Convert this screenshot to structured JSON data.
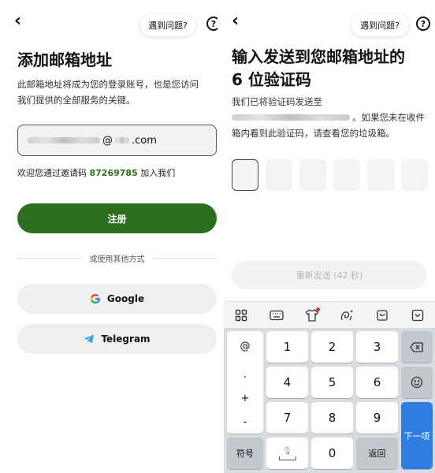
{
  "left": {
    "problem_label": "遇到问题?",
    "help_glyph": "?",
    "back_glyph": "‹",
    "title": "添加邮箱地址",
    "description_line1": "此邮箱地址将成为您的登录账号，也是您访问",
    "description_line2": "我们提供的全部服务的关键。",
    "email_visible_suffix": ".com",
    "email_visible_at": "@",
    "invite_prefix": "欢迎您通过邀请码",
    "invite_code": "87269785",
    "invite_suffix": "加入我们",
    "register_label": "注册",
    "separator_text": "或使用其他方式",
    "google_label": "Google",
    "telegram_label": "Telegram",
    "colors": {
      "primary": "#2c6e1f",
      "invite_code": "#2e6e1a"
    }
  },
  "right": {
    "problem_label": "遇到问题?",
    "help_glyph": "?",
    "back_glyph": "‹",
    "title_line1": "输入发送到您邮箱地址的",
    "title_line2": "6 位验证码",
    "sent_to_label": "我们已将验证码发送至",
    "sent_line2_suffix": "。如果您未在收件",
    "sent_line3": "箱内看到此验证码，请查看您的垃圾箱。",
    "code_length": 6,
    "resend_label": "重新发送 (42 秒)"
  },
  "keyboard": {
    "toolbar_icons": [
      "grid-icon",
      "keyboard-icon",
      "tshirt-icon",
      "ai-swirl-icon",
      "clipboard-icon",
      "collapse-icon"
    ],
    "symbols": [
      "@",
      ".",
      "+",
      "-"
    ],
    "digits": [
      "1",
      "2",
      "3",
      "4",
      "5",
      "6",
      "7",
      "8",
      "9",
      "0"
    ],
    "symbol_key": "符号",
    "return_key": "返回",
    "next_key": "下一项",
    "space_mic": "🎙"
  }
}
